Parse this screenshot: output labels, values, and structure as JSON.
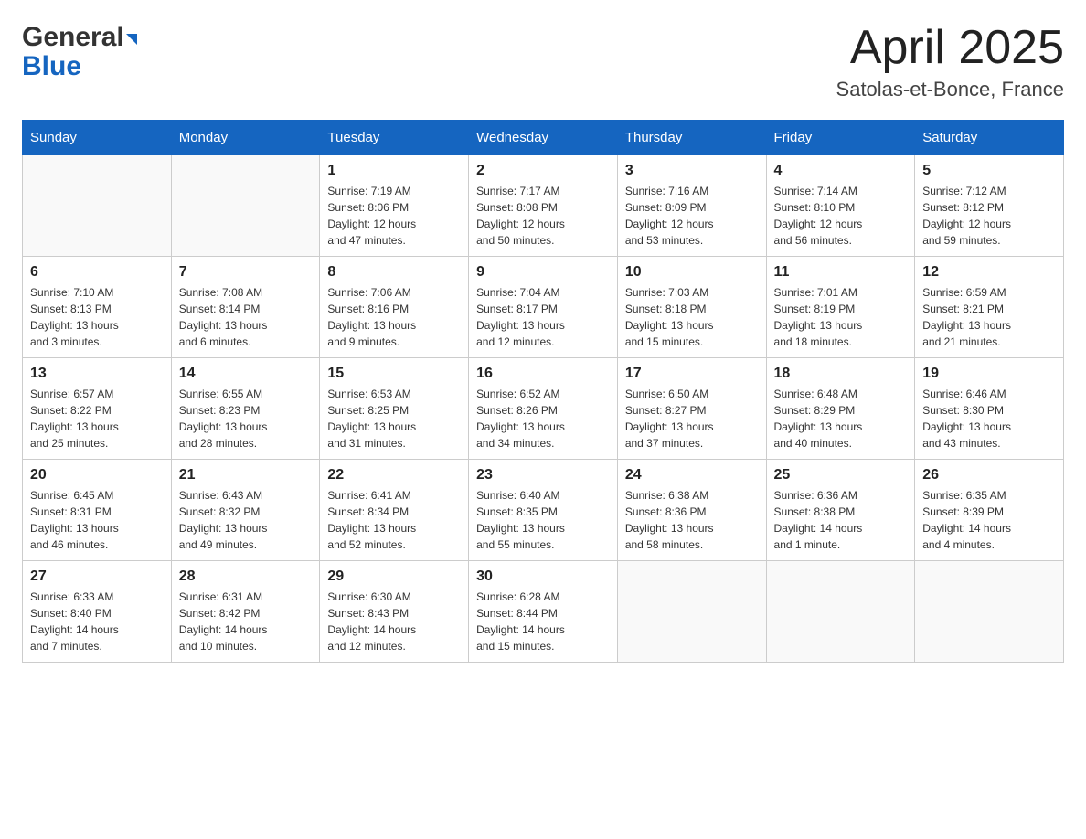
{
  "header": {
    "logo_general": "General",
    "logo_blue": "Blue",
    "title": "April 2025",
    "location": "Satolas-et-Bonce, France"
  },
  "columns": [
    "Sunday",
    "Monday",
    "Tuesday",
    "Wednesday",
    "Thursday",
    "Friday",
    "Saturday"
  ],
  "weeks": [
    [
      {
        "day": "",
        "info": ""
      },
      {
        "day": "",
        "info": ""
      },
      {
        "day": "1",
        "info": "Sunrise: 7:19 AM\nSunset: 8:06 PM\nDaylight: 12 hours\nand 47 minutes."
      },
      {
        "day": "2",
        "info": "Sunrise: 7:17 AM\nSunset: 8:08 PM\nDaylight: 12 hours\nand 50 minutes."
      },
      {
        "day": "3",
        "info": "Sunrise: 7:16 AM\nSunset: 8:09 PM\nDaylight: 12 hours\nand 53 minutes."
      },
      {
        "day": "4",
        "info": "Sunrise: 7:14 AM\nSunset: 8:10 PM\nDaylight: 12 hours\nand 56 minutes."
      },
      {
        "day": "5",
        "info": "Sunrise: 7:12 AM\nSunset: 8:12 PM\nDaylight: 12 hours\nand 59 minutes."
      }
    ],
    [
      {
        "day": "6",
        "info": "Sunrise: 7:10 AM\nSunset: 8:13 PM\nDaylight: 13 hours\nand 3 minutes."
      },
      {
        "day": "7",
        "info": "Sunrise: 7:08 AM\nSunset: 8:14 PM\nDaylight: 13 hours\nand 6 minutes."
      },
      {
        "day": "8",
        "info": "Sunrise: 7:06 AM\nSunset: 8:16 PM\nDaylight: 13 hours\nand 9 minutes."
      },
      {
        "day": "9",
        "info": "Sunrise: 7:04 AM\nSunset: 8:17 PM\nDaylight: 13 hours\nand 12 minutes."
      },
      {
        "day": "10",
        "info": "Sunrise: 7:03 AM\nSunset: 8:18 PM\nDaylight: 13 hours\nand 15 minutes."
      },
      {
        "day": "11",
        "info": "Sunrise: 7:01 AM\nSunset: 8:19 PM\nDaylight: 13 hours\nand 18 minutes."
      },
      {
        "day": "12",
        "info": "Sunrise: 6:59 AM\nSunset: 8:21 PM\nDaylight: 13 hours\nand 21 minutes."
      }
    ],
    [
      {
        "day": "13",
        "info": "Sunrise: 6:57 AM\nSunset: 8:22 PM\nDaylight: 13 hours\nand 25 minutes."
      },
      {
        "day": "14",
        "info": "Sunrise: 6:55 AM\nSunset: 8:23 PM\nDaylight: 13 hours\nand 28 minutes."
      },
      {
        "day": "15",
        "info": "Sunrise: 6:53 AM\nSunset: 8:25 PM\nDaylight: 13 hours\nand 31 minutes."
      },
      {
        "day": "16",
        "info": "Sunrise: 6:52 AM\nSunset: 8:26 PM\nDaylight: 13 hours\nand 34 minutes."
      },
      {
        "day": "17",
        "info": "Sunrise: 6:50 AM\nSunset: 8:27 PM\nDaylight: 13 hours\nand 37 minutes."
      },
      {
        "day": "18",
        "info": "Sunrise: 6:48 AM\nSunset: 8:29 PM\nDaylight: 13 hours\nand 40 minutes."
      },
      {
        "day": "19",
        "info": "Sunrise: 6:46 AM\nSunset: 8:30 PM\nDaylight: 13 hours\nand 43 minutes."
      }
    ],
    [
      {
        "day": "20",
        "info": "Sunrise: 6:45 AM\nSunset: 8:31 PM\nDaylight: 13 hours\nand 46 minutes."
      },
      {
        "day": "21",
        "info": "Sunrise: 6:43 AM\nSunset: 8:32 PM\nDaylight: 13 hours\nand 49 minutes."
      },
      {
        "day": "22",
        "info": "Sunrise: 6:41 AM\nSunset: 8:34 PM\nDaylight: 13 hours\nand 52 minutes."
      },
      {
        "day": "23",
        "info": "Sunrise: 6:40 AM\nSunset: 8:35 PM\nDaylight: 13 hours\nand 55 minutes."
      },
      {
        "day": "24",
        "info": "Sunrise: 6:38 AM\nSunset: 8:36 PM\nDaylight: 13 hours\nand 58 minutes."
      },
      {
        "day": "25",
        "info": "Sunrise: 6:36 AM\nSunset: 8:38 PM\nDaylight: 14 hours\nand 1 minute."
      },
      {
        "day": "26",
        "info": "Sunrise: 6:35 AM\nSunset: 8:39 PM\nDaylight: 14 hours\nand 4 minutes."
      }
    ],
    [
      {
        "day": "27",
        "info": "Sunrise: 6:33 AM\nSunset: 8:40 PM\nDaylight: 14 hours\nand 7 minutes."
      },
      {
        "day": "28",
        "info": "Sunrise: 6:31 AM\nSunset: 8:42 PM\nDaylight: 14 hours\nand 10 minutes."
      },
      {
        "day": "29",
        "info": "Sunrise: 6:30 AM\nSunset: 8:43 PM\nDaylight: 14 hours\nand 12 minutes."
      },
      {
        "day": "30",
        "info": "Sunrise: 6:28 AM\nSunset: 8:44 PM\nDaylight: 14 hours\nand 15 minutes."
      },
      {
        "day": "",
        "info": ""
      },
      {
        "day": "",
        "info": ""
      },
      {
        "day": "",
        "info": ""
      }
    ]
  ]
}
